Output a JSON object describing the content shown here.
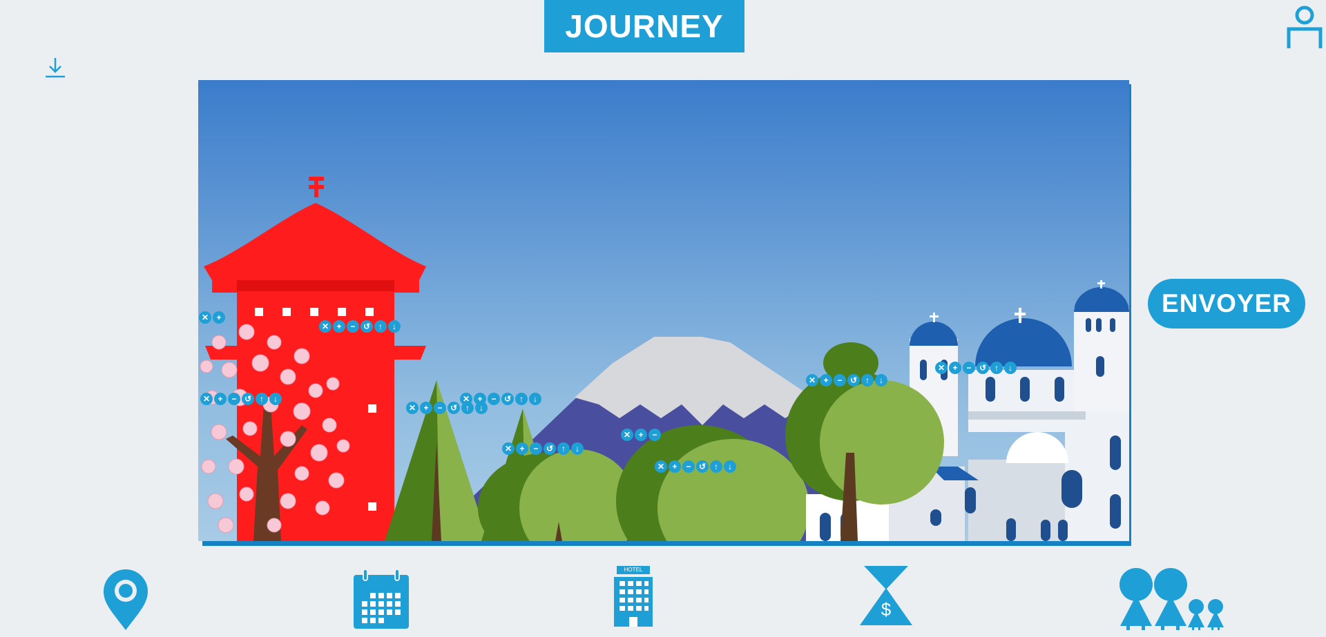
{
  "header": {
    "title": "JOURNEY"
  },
  "actions": {
    "send_label": "ENVOYER"
  },
  "icons": {
    "download": "download-icon",
    "user": "user-icon",
    "toolbar_buttons": [
      "close-icon",
      "plus-icon",
      "minus-icon",
      "rotate-icon",
      "arrow-up-icon",
      "arrow-down-icon"
    ]
  },
  "toolbar": {
    "glyphs": [
      "✕",
      "+",
      "−",
      "↺",
      "↑",
      "↓"
    ]
  },
  "scene_elements": [
    "pagoda",
    "cherry-blossom-tree",
    "mount-fuji",
    "pine-trees",
    "bushes",
    "round-tree",
    "santorini-church",
    "houses"
  ],
  "bottom_nav": [
    {
      "name": "location",
      "icon": "location-pin-icon"
    },
    {
      "name": "calendar",
      "icon": "calendar-icon"
    },
    {
      "name": "hotel",
      "icon": "hotel-icon",
      "label": "HOTEL"
    },
    {
      "name": "budget",
      "icon": "hourglass-dollar-icon",
      "label": "$"
    },
    {
      "name": "travelers",
      "icon": "family-icon"
    }
  ],
  "colors": {
    "accent": "#1ea0d7",
    "sky_top": "#3b7ccb",
    "sky_bottom": "#92bde0",
    "pagoda": "#ff1c1c",
    "background": "#eceff2"
  }
}
